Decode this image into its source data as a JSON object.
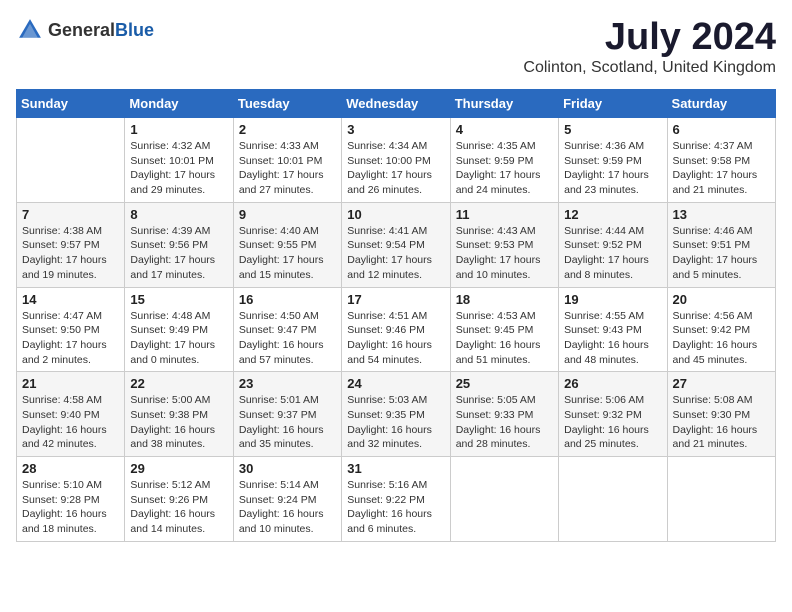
{
  "header": {
    "logo_general": "General",
    "logo_blue": "Blue",
    "month_title": "July 2024",
    "location": "Colinton, Scotland, United Kingdom"
  },
  "weekdays": [
    "Sunday",
    "Monday",
    "Tuesday",
    "Wednesday",
    "Thursday",
    "Friday",
    "Saturday"
  ],
  "weeks": [
    [
      {
        "day": "",
        "sunrise": "",
        "sunset": "",
        "daylight": ""
      },
      {
        "day": "1",
        "sunrise": "Sunrise: 4:32 AM",
        "sunset": "Sunset: 10:01 PM",
        "daylight": "Daylight: 17 hours and 29 minutes."
      },
      {
        "day": "2",
        "sunrise": "Sunrise: 4:33 AM",
        "sunset": "Sunset: 10:01 PM",
        "daylight": "Daylight: 17 hours and 27 minutes."
      },
      {
        "day": "3",
        "sunrise": "Sunrise: 4:34 AM",
        "sunset": "Sunset: 10:00 PM",
        "daylight": "Daylight: 17 hours and 26 minutes."
      },
      {
        "day": "4",
        "sunrise": "Sunrise: 4:35 AM",
        "sunset": "Sunset: 9:59 PM",
        "daylight": "Daylight: 17 hours and 24 minutes."
      },
      {
        "day": "5",
        "sunrise": "Sunrise: 4:36 AM",
        "sunset": "Sunset: 9:59 PM",
        "daylight": "Daylight: 17 hours and 23 minutes."
      },
      {
        "day": "6",
        "sunrise": "Sunrise: 4:37 AM",
        "sunset": "Sunset: 9:58 PM",
        "daylight": "Daylight: 17 hours and 21 minutes."
      }
    ],
    [
      {
        "day": "7",
        "sunrise": "Sunrise: 4:38 AM",
        "sunset": "Sunset: 9:57 PM",
        "daylight": "Daylight: 17 hours and 19 minutes."
      },
      {
        "day": "8",
        "sunrise": "Sunrise: 4:39 AM",
        "sunset": "Sunset: 9:56 PM",
        "daylight": "Daylight: 17 hours and 17 minutes."
      },
      {
        "day": "9",
        "sunrise": "Sunrise: 4:40 AM",
        "sunset": "Sunset: 9:55 PM",
        "daylight": "Daylight: 17 hours and 15 minutes."
      },
      {
        "day": "10",
        "sunrise": "Sunrise: 4:41 AM",
        "sunset": "Sunset: 9:54 PM",
        "daylight": "Daylight: 17 hours and 12 minutes."
      },
      {
        "day": "11",
        "sunrise": "Sunrise: 4:43 AM",
        "sunset": "Sunset: 9:53 PM",
        "daylight": "Daylight: 17 hours and 10 minutes."
      },
      {
        "day": "12",
        "sunrise": "Sunrise: 4:44 AM",
        "sunset": "Sunset: 9:52 PM",
        "daylight": "Daylight: 17 hours and 8 minutes."
      },
      {
        "day": "13",
        "sunrise": "Sunrise: 4:46 AM",
        "sunset": "Sunset: 9:51 PM",
        "daylight": "Daylight: 17 hours and 5 minutes."
      }
    ],
    [
      {
        "day": "14",
        "sunrise": "Sunrise: 4:47 AM",
        "sunset": "Sunset: 9:50 PM",
        "daylight": "Daylight: 17 hours and 2 minutes."
      },
      {
        "day": "15",
        "sunrise": "Sunrise: 4:48 AM",
        "sunset": "Sunset: 9:49 PM",
        "daylight": "Daylight: 17 hours and 0 minutes."
      },
      {
        "day": "16",
        "sunrise": "Sunrise: 4:50 AM",
        "sunset": "Sunset: 9:47 PM",
        "daylight": "Daylight: 16 hours and 57 minutes."
      },
      {
        "day": "17",
        "sunrise": "Sunrise: 4:51 AM",
        "sunset": "Sunset: 9:46 PM",
        "daylight": "Daylight: 16 hours and 54 minutes."
      },
      {
        "day": "18",
        "sunrise": "Sunrise: 4:53 AM",
        "sunset": "Sunset: 9:45 PM",
        "daylight": "Daylight: 16 hours and 51 minutes."
      },
      {
        "day": "19",
        "sunrise": "Sunrise: 4:55 AM",
        "sunset": "Sunset: 9:43 PM",
        "daylight": "Daylight: 16 hours and 48 minutes."
      },
      {
        "day": "20",
        "sunrise": "Sunrise: 4:56 AM",
        "sunset": "Sunset: 9:42 PM",
        "daylight": "Daylight: 16 hours and 45 minutes."
      }
    ],
    [
      {
        "day": "21",
        "sunrise": "Sunrise: 4:58 AM",
        "sunset": "Sunset: 9:40 PM",
        "daylight": "Daylight: 16 hours and 42 minutes."
      },
      {
        "day": "22",
        "sunrise": "Sunrise: 5:00 AM",
        "sunset": "Sunset: 9:38 PM",
        "daylight": "Daylight: 16 hours and 38 minutes."
      },
      {
        "day": "23",
        "sunrise": "Sunrise: 5:01 AM",
        "sunset": "Sunset: 9:37 PM",
        "daylight": "Daylight: 16 hours and 35 minutes."
      },
      {
        "day": "24",
        "sunrise": "Sunrise: 5:03 AM",
        "sunset": "Sunset: 9:35 PM",
        "daylight": "Daylight: 16 hours and 32 minutes."
      },
      {
        "day": "25",
        "sunrise": "Sunrise: 5:05 AM",
        "sunset": "Sunset: 9:33 PM",
        "daylight": "Daylight: 16 hours and 28 minutes."
      },
      {
        "day": "26",
        "sunrise": "Sunrise: 5:06 AM",
        "sunset": "Sunset: 9:32 PM",
        "daylight": "Daylight: 16 hours and 25 minutes."
      },
      {
        "day": "27",
        "sunrise": "Sunrise: 5:08 AM",
        "sunset": "Sunset: 9:30 PM",
        "daylight": "Daylight: 16 hours and 21 minutes."
      }
    ],
    [
      {
        "day": "28",
        "sunrise": "Sunrise: 5:10 AM",
        "sunset": "Sunset: 9:28 PM",
        "daylight": "Daylight: 16 hours and 18 minutes."
      },
      {
        "day": "29",
        "sunrise": "Sunrise: 5:12 AM",
        "sunset": "Sunset: 9:26 PM",
        "daylight": "Daylight: 16 hours and 14 minutes."
      },
      {
        "day": "30",
        "sunrise": "Sunrise: 5:14 AM",
        "sunset": "Sunset: 9:24 PM",
        "daylight": "Daylight: 16 hours and 10 minutes."
      },
      {
        "day": "31",
        "sunrise": "Sunrise: 5:16 AM",
        "sunset": "Sunset: 9:22 PM",
        "daylight": "Daylight: 16 hours and 6 minutes."
      },
      {
        "day": "",
        "sunrise": "",
        "sunset": "",
        "daylight": ""
      },
      {
        "day": "",
        "sunrise": "",
        "sunset": "",
        "daylight": ""
      },
      {
        "day": "",
        "sunrise": "",
        "sunset": "",
        "daylight": ""
      }
    ]
  ]
}
